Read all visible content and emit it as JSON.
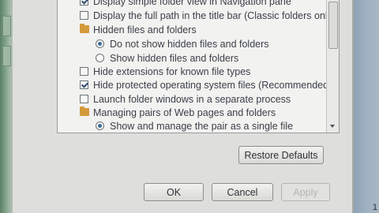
{
  "dialog": {
    "options": [
      {
        "type": "checkbox",
        "checked": true,
        "label": "Display simple folder view in Navigation pane"
      },
      {
        "type": "checkbox",
        "checked": false,
        "label": "Display the full path in the title bar (Classic folders only)"
      },
      {
        "type": "folder",
        "label": "Hidden files and folders"
      },
      {
        "type": "radio",
        "selected": true,
        "label": "Do not show hidden files and folders"
      },
      {
        "type": "radio",
        "selected": false,
        "label": "Show hidden files and folders"
      },
      {
        "type": "checkbox",
        "checked": false,
        "label": "Hide extensions for known file types"
      },
      {
        "type": "checkbox",
        "checked": true,
        "label": "Hide protected operating system files (Recommended)"
      },
      {
        "type": "checkbox",
        "checked": false,
        "label": "Launch folder windows in a separate process"
      },
      {
        "type": "folder",
        "label": "Managing pairs of Web pages and folders"
      },
      {
        "type": "radio",
        "selected": true,
        "label": "Show and manage the pair as a single file"
      }
    ],
    "restore_defaults_label": "Restore Defaults",
    "ok_label": "OK",
    "cancel_label": "Cancel",
    "apply_label": "Apply"
  },
  "taskbar": {
    "clock_text": "1"
  }
}
